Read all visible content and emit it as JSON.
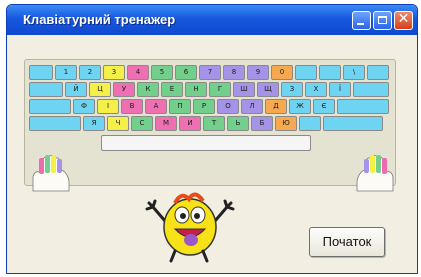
{
  "window": {
    "title": "Клавіатурний тренажер",
    "controls": {
      "minimize": "minimize-icon",
      "maximize": "maximize-icon",
      "close": "close-icon",
      "close_glyph": "✕"
    }
  },
  "keyboard": {
    "colors": {
      "c": "#6fd4f2",
      "y": "#f5ef4a",
      "p": "#ee6fb2",
      "g": "#73cf8c",
      "v": "#a493e6",
      "o": "#f6a94f"
    },
    "rows": [
      [
        {
          "t": "",
          "c": "c"
        },
        {
          "t": "1",
          "c": "c"
        },
        {
          "t": "2",
          "c": "c"
        },
        {
          "t": "3",
          "c": "y"
        },
        {
          "t": "4",
          "c": "p"
        },
        {
          "t": "5",
          "c": "g"
        },
        {
          "t": "6",
          "c": "g"
        },
        {
          "t": "7",
          "c": "v"
        },
        {
          "t": "8",
          "c": "v"
        },
        {
          "t": "9",
          "c": "v"
        },
        {
          "t": "0",
          "c": "o"
        },
        {
          "t": "",
          "c": "c"
        },
        {
          "t": "",
          "c": "c"
        },
        {
          "t": "\\",
          "c": "c"
        },
        {
          "t": "",
          "c": "c"
        }
      ],
      [
        {
          "t": "",
          "c": "c"
        },
        {
          "t": "Й",
          "c": "c"
        },
        {
          "t": "Ц",
          "c": "y"
        },
        {
          "t": "У",
          "c": "p"
        },
        {
          "t": "К",
          "c": "g"
        },
        {
          "t": "Е",
          "c": "g"
        },
        {
          "t": "Н",
          "c": "g"
        },
        {
          "t": "Г",
          "c": "g"
        },
        {
          "t": "Ш",
          "c": "v"
        },
        {
          "t": "Щ",
          "c": "v"
        },
        {
          "t": "З",
          "c": "c"
        },
        {
          "t": "Х",
          "c": "c"
        },
        {
          "t": "Ї",
          "c": "c"
        },
        {
          "t": "",
          "c": "c"
        }
      ],
      [
        {
          "t": "",
          "c": "c"
        },
        {
          "t": "Ф",
          "c": "c"
        },
        {
          "t": "І",
          "c": "y"
        },
        {
          "t": "В",
          "c": "p"
        },
        {
          "t": "А",
          "c": "p"
        },
        {
          "t": "П",
          "c": "g"
        },
        {
          "t": "Р",
          "c": "g"
        },
        {
          "t": "О",
          "c": "v"
        },
        {
          "t": "Л",
          "c": "v"
        },
        {
          "t": "Д",
          "c": "o"
        },
        {
          "t": "Ж",
          "c": "c"
        },
        {
          "t": "Є",
          "c": "c"
        },
        {
          "t": "",
          "c": "c"
        }
      ],
      [
        {
          "t": "",
          "c": "c"
        },
        {
          "t": "Я",
          "c": "c"
        },
        {
          "t": "Ч",
          "c": "y"
        },
        {
          "t": "С",
          "c": "g"
        },
        {
          "t": "М",
          "c": "p"
        },
        {
          "t": "И",
          "c": "p"
        },
        {
          "t": "Т",
          "c": "g"
        },
        {
          "t": "Ь",
          "c": "g"
        },
        {
          "t": "Б",
          "c": "v"
        },
        {
          "t": "Ю",
          "c": "o"
        },
        {
          "t": "",
          "c": "c"
        },
        {
          "t": "",
          "c": "c"
        }
      ]
    ],
    "spacebar_color": "#f5f5f5"
  },
  "start_button": {
    "label": "Початок"
  }
}
